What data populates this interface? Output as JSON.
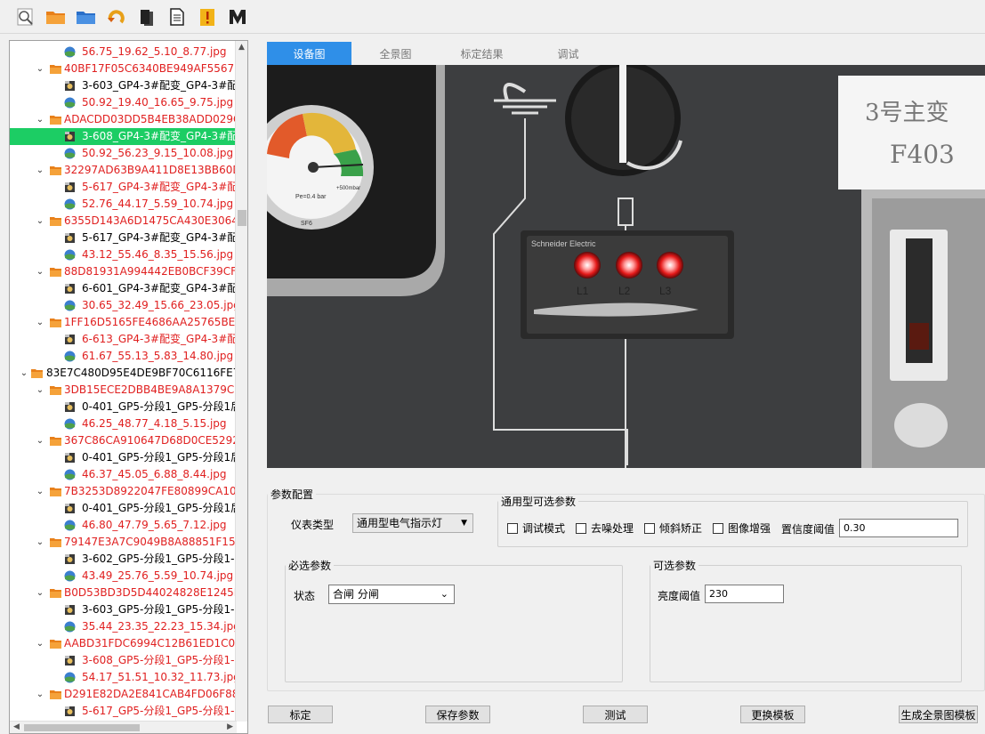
{
  "toolbar": {
    "buttons": [
      {
        "name": "zoom-icon"
      },
      {
        "name": "open-folder-icon"
      },
      {
        "name": "folder-icon"
      },
      {
        "name": "refresh-icon"
      },
      {
        "name": "book-icon"
      },
      {
        "name": "document-icon"
      },
      {
        "name": "warning-icon"
      },
      {
        "name": "m-logo-icon"
      }
    ]
  },
  "tree": {
    "rows": [
      {
        "text": "56.75_19.62_5.10_8.77.jpg",
        "color": "red",
        "kind": "globe",
        "level": 2
      },
      {
        "text": "40BF17F05C6340BE949AF556730",
        "color": "red",
        "kind": "folder",
        "level": 1
      },
      {
        "text": "3-603_GP4-3#配变_GP4-3#配",
        "color": "blk",
        "kind": "cam",
        "level": 2
      },
      {
        "text": "50.92_19.40_16.65_9.75.jpg",
        "color": "red",
        "kind": "globe",
        "level": 2
      },
      {
        "text": "ADACDD03DD5B4EB38ADD029C",
        "color": "red",
        "kind": "folder",
        "level": 1
      },
      {
        "text": "3-608_GP4-3#配变_GP4-3#配",
        "color": "sel",
        "kind": "cam",
        "level": 2
      },
      {
        "text": "50.92_56.23_9.15_10.08.jpg",
        "color": "red",
        "kind": "globe",
        "level": 2
      },
      {
        "text": "32297AD63B9A411D8E13BB60D",
        "color": "red",
        "kind": "folder",
        "level": 1
      },
      {
        "text": "5-617_GP4-3#配变_GP4-3#配",
        "color": "red",
        "kind": "cam",
        "level": 2
      },
      {
        "text": "52.76_44.17_5.59_10.74.jpg",
        "color": "red",
        "kind": "globe",
        "level": 2
      },
      {
        "text": "6355D143A6D1475CA430E30642",
        "color": "red",
        "kind": "folder",
        "level": 1
      },
      {
        "text": "5-617_GP4-3#配变_GP4-3#配",
        "color": "blk",
        "kind": "cam",
        "level": 2
      },
      {
        "text": "43.12_55.46_8.35_15.56.jpg",
        "color": "red",
        "kind": "globe",
        "level": 2
      },
      {
        "text": "88D81931A994442EB0BCF39CFE",
        "color": "red",
        "kind": "folder",
        "level": 1
      },
      {
        "text": "6-601_GP4-3#配变_GP4-3#配",
        "color": "blk",
        "kind": "cam",
        "level": 2
      },
      {
        "text": "30.65_32.49_15.66_23.05.jpg",
        "color": "red",
        "kind": "globe",
        "level": 2
      },
      {
        "text": "1FF16D5165FE4686AA25765BE2",
        "color": "red",
        "kind": "folder",
        "level": 1
      },
      {
        "text": "6-613_GP4-3#配变_GP4-3#配",
        "color": "red",
        "kind": "cam",
        "level": 2
      },
      {
        "text": "61.67_55.13_5.83_14.80.jpg",
        "color": "red",
        "kind": "globe",
        "level": 2
      },
      {
        "text": "83E7C480D95E4DE9BF70C6116FE7D",
        "color": "blk",
        "kind": "folder",
        "level": 0
      },
      {
        "text": "3DB15ECE2DBB4BE9A8A1379C3",
        "color": "red",
        "kind": "folder",
        "level": 1
      },
      {
        "text": "0-401_GP5-分段1_GP5-分段1后",
        "color": "blk",
        "kind": "cam",
        "level": 2
      },
      {
        "text": "46.25_48.77_4.18_5.15.jpg",
        "color": "red",
        "kind": "globe",
        "level": 2
      },
      {
        "text": "367C86CA910647D68D0CE52926",
        "color": "red",
        "kind": "folder",
        "level": 1
      },
      {
        "text": "0-401_GP5-分段1_GP5-分段1后",
        "color": "blk",
        "kind": "cam",
        "level": 2
      },
      {
        "text": "46.37_45.05_6.88_8.44.jpg",
        "color": "red",
        "kind": "globe",
        "level": 2
      },
      {
        "text": "7B3253D8922047FE80899CA106",
        "color": "red",
        "kind": "folder",
        "level": 1
      },
      {
        "text": "0-401_GP5-分段1_GP5-分段1后",
        "color": "blk",
        "kind": "cam",
        "level": 2
      },
      {
        "text": "46.80_47.79_5.65_7.12.jpg",
        "color": "red",
        "kind": "globe",
        "level": 2
      },
      {
        "text": "79147E3A7C9049B8A88851F15D",
        "color": "red",
        "kind": "folder",
        "level": 1
      },
      {
        "text": "3-602_GP5-分段1_GP5-分段1-",
        "color": "blk",
        "kind": "cam",
        "level": 2
      },
      {
        "text": "43.49_25.76_5.59_10.74.jpg",
        "color": "red",
        "kind": "globe",
        "level": 2
      },
      {
        "text": "B0D53BD3D5D44024828E1245F",
        "color": "red",
        "kind": "folder",
        "level": 1
      },
      {
        "text": "3-603_GP5-分段1_GP5-分段1-",
        "color": "blk",
        "kind": "cam",
        "level": 2
      },
      {
        "text": "35.44_23.35_22.23_15.34.jpg",
        "color": "red",
        "kind": "globe",
        "level": 2
      },
      {
        "text": "AABD31FDC6994C12B61ED1C0B",
        "color": "red",
        "kind": "folder",
        "level": 1
      },
      {
        "text": "3-608_GP5-分段1_GP5-分段1-",
        "color": "red",
        "kind": "cam",
        "level": 2
      },
      {
        "text": "54.17_51.51_10.32_11.73.jpg",
        "color": "red",
        "kind": "globe",
        "level": 2
      },
      {
        "text": "D291E82DA2E841CAB4FD06F88E",
        "color": "red",
        "kind": "folder",
        "level": 1
      },
      {
        "text": "5-617_GP5-分段1_GP5-分段1-",
        "color": "red",
        "kind": "cam",
        "level": 2
      }
    ]
  },
  "tabs": [
    "设备图",
    "全景图",
    "标定结果",
    "调试"
  ],
  "image": {
    "gauge_text": "Pe=0.4 bar",
    "gauge_sub": "SF6",
    "gauge_right": "+500mbar",
    "brand": "Schneider Electric",
    "labels": [
      "L1",
      "L2",
      "L3"
    ],
    "sign_line1": "3号主变",
    "sign_line2": "F403"
  },
  "params": {
    "group_title": "参数配置",
    "meter_type_label": "仪表类型",
    "meter_type_value": "通用型电气指示灯",
    "optional_title": "通用型可选参数",
    "checkboxes": [
      "调试模式",
      "去噪处理",
      "倾斜矫正",
      "图像增强"
    ],
    "confidence_label": "置信度阈值",
    "confidence_value": "0.30",
    "required_title": "必选参数",
    "state_label": "状态",
    "state_value": "合闸 分闸",
    "opt_title": "可选参数",
    "brightness_label": "亮度阈值",
    "brightness_value": "230"
  },
  "buttons": [
    "标定",
    "保存参数",
    "测试",
    "更换模板",
    "生成全景图模板"
  ]
}
